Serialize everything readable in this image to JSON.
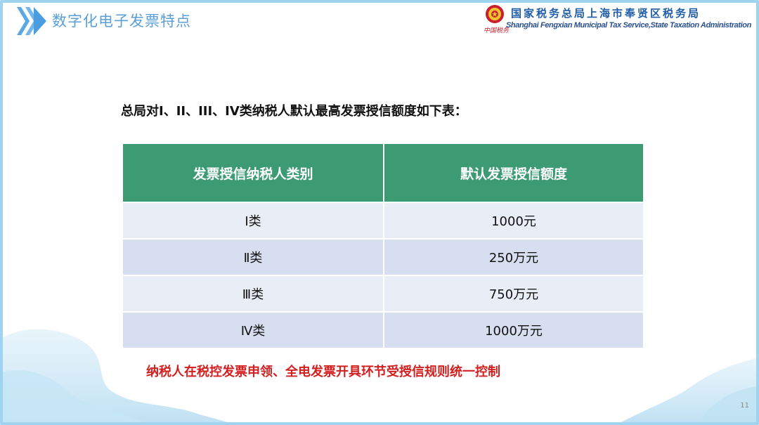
{
  "header": {
    "title": "数字化电子发票特点",
    "org_name_cn": "国家税务总局上海市奉贤区税务局",
    "org_name_en": "Shanghai Fengxian Municipal Tax Service,State Taxation Administration",
    "brand_mark": "中国税务",
    "accent_color": "#5a9fd8"
  },
  "intro": "总局对I、II、III、IV类纳税人默认最高发票授信额度如下表：",
  "table": {
    "headers": [
      "发票授信纳税人类别",
      "默认发票授信额度"
    ],
    "rows": [
      [
        "Ⅰ类",
        "1000元"
      ],
      [
        "Ⅱ类",
        "250万元"
      ],
      [
        "Ⅲ类",
        "750万元"
      ],
      [
        "Ⅳ类",
        "1000万元"
      ]
    ],
    "header_color": "#3d9b74"
  },
  "note": "纳税人在税控发票申领、全电发票开具环节受授信规则统一控制",
  "note_color": "#d21f1f",
  "page_number": "11"
}
